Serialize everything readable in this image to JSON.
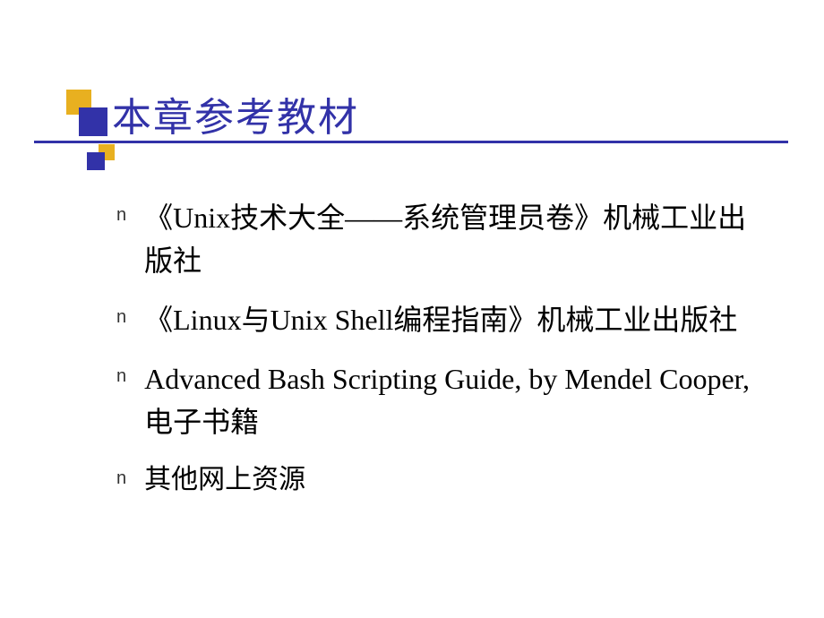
{
  "title": "本章参考教材",
  "bullets": [
    {
      "marker": "n",
      "text": "《Unix技术大全——系统管理员卷》机械工业出版社"
    },
    {
      "marker": "n",
      "text": "《Linux与Unix Shell编程指南》机械工业出版社"
    },
    {
      "marker": "n",
      "text": "Advanced Bash Scripting Guide, by Mendel Cooper, 电子书籍"
    },
    {
      "marker": "n",
      "text": "其他网上资源"
    }
  ]
}
